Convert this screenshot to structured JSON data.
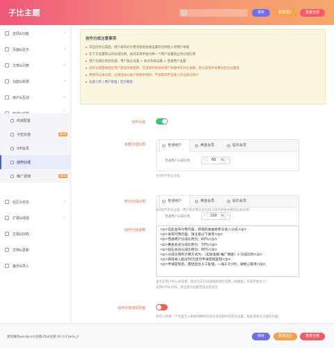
{
  "header": {
    "title": "子比主题",
    "search_icon": "search-icon",
    "save_label": "保存",
    "reset_section_label": "重置选区",
    "reset_all_label": "重置全部"
  },
  "sidebar": {
    "items": [
      {
        "label": "全局&功能",
        "icon": "settings-icon"
      },
      {
        "label": "页面&显示",
        "icon": "layout-icon"
      },
      {
        "label": "文章&列表",
        "icon": "article-icon"
      },
      {
        "label": "功能&权限",
        "icon": "lock-icon"
      },
      {
        "label": "用户&互动",
        "icon": "user-icon"
      },
      {
        "label": "商城&付费",
        "icon": "shop-icon"
      }
    ],
    "subitems": [
      {
        "label": "商城配置",
        "badge": ""
      },
      {
        "label": "卡密充值",
        "badge": "NEW"
      },
      {
        "label": "VIP会员",
        "badge": ""
      },
      {
        "label": "创作分成",
        "badge": ""
      },
      {
        "label": "推广返佣",
        "badge": "NEW"
      }
    ],
    "items_bottom": [
      {
        "label": "社区&论坛",
        "icon": "community-icon"
      },
      {
        "label": "扩展&增强",
        "icon": "extension-icon"
      },
      {
        "label": "主题&授权",
        "icon": "key-icon"
      },
      {
        "label": "文档&更新",
        "icon": "doc-icon"
      },
      {
        "label": "备份&导入",
        "icon": "backup-icon"
      }
    ]
  },
  "notice": {
    "title": "创作分成注意事项",
    "lines": [
      {
        "text": "开启创作分成后，用户发布的付费内容则会按设置的比例给入到用户余额",
        "style": "normal"
      },
      {
        "text": "在下方设置默认的分成比例，再对支持单独为每一个用户设置独立的分成比例",
        "style": "normal"
      },
      {
        "text": "用户分成比例优先级：用户独立设置 > 会员等级设置 > 普通用户设置",
        "style": "normal"
      },
      {
        "text": "创作分成需要配合用户提现功能使用，在提现时会扣除用户余额中的对应金额，默认提现手续费为后台设置值",
        "style": "warn"
      },
      {
        "text": "费用仅记录分成，分成后会从账户余额中扣除，不会影响平台收入的记录与统计",
        "style": "warn"
      },
      {
        "text": "注意订单 | 用户管理 | 官方教程",
        "style": "links"
      }
    ]
  },
  "settings": {
    "creator_share": {
      "label": "创作分成",
      "enabled": true
    },
    "balance_ratio": {
      "label": "余额分成比例",
      "tabs": [
        "普通用户",
        "黄金会员",
        "钻石会员"
      ],
      "active_tab": 0,
      "field_label": "普通用户分成比例",
      "value": "60",
      "unit": "%",
      "help": "为0则不参与分成"
    },
    "points_ratio": {
      "label": "积分分成比例",
      "tabs": [
        "普通用户",
        "黄金会员",
        "钻石会员"
      ],
      "active_tab": 0,
      "field_label": "普通用户分成比例",
      "value": "100",
      "unit": "%",
      "help": "为0则不参与分成（用户购买积分支付的订单仍然按本费的分成比例）"
    },
    "description": {
      "label": "创作分成说明",
      "lines": [
        "<p>在此发布付费内容，获得的收益将参与收入分成</p>",
        "<p>发布付费内容，请注意以下事项</p>",
        "<p>普通用户分成比例为：60%</p>",
        "<p>黄金会员分成比例为：70%</p>",
        "<p>钻石会员分成比例为：80%</p>",
        "<p>分成比例的计算方式为：（实收金额-推广佣金）x 分成比例</p>",
        "<p>获得收入超过50元后可申请提现提现</p>",
        "<p>申请提现后，需经后台人工处理，一般2-3小时，请耐心等待</p>"
      ],
      "help1": "显示在用户中心的说明，建议为支付分成规则进行说明（如模板，内容不要太少）",
      "help2": "支持HTML代码，请注意代码规范及标签闭合"
    },
    "force_page": {
      "label": "创作分成详情页面",
      "enabled": false,
      "help": "你可以新建一个页面写入更加详细的创作分成说明并在后台设置，再此选择该页面的页面。"
    }
  },
  "footer": {
    "version_text": "更优雅的wordpress主题-Zibll主题 V6.4.0.beta_2",
    "save_label": "保存",
    "reset_section_label": "重置选区",
    "reset_all_label": "重置全部"
  },
  "colors": {
    "header_gradient": [
      "#f0567a",
      "#f6a96b"
    ],
    "save": "#6c6ff0",
    "reset_section": "#f6a04b",
    "reset_all": "#f15a66",
    "toggle_on": "#3ec07a",
    "toggle_off": "#f0614d",
    "label_accent": "#e0693a",
    "active_nav": "#4a63c8"
  }
}
